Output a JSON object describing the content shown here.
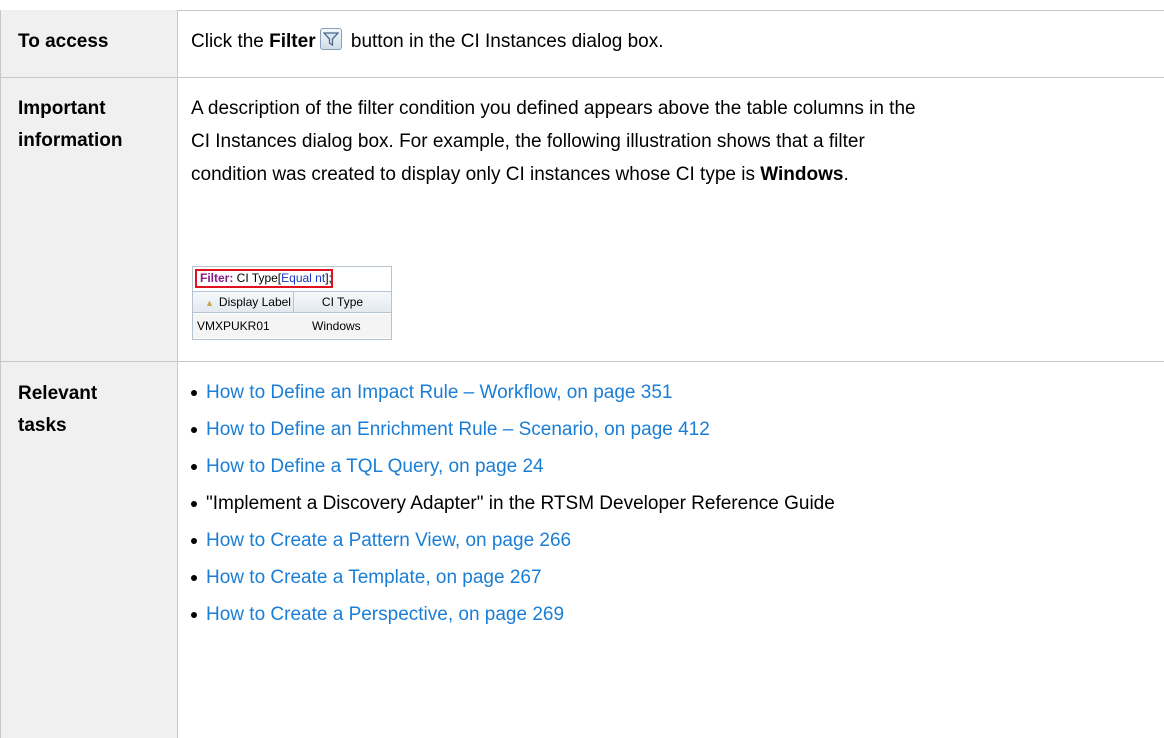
{
  "rows": {
    "access": {
      "label": "To access",
      "pre": "Click the ",
      "bold": "Filter",
      "post": " button in the CI Instances dialog box.",
      "icon": "filter-icon"
    },
    "important": {
      "label_line1": "Important",
      "label_line2": "information",
      "line1": "A description of the filter condition you defined appears above the table columns in the",
      "line2": "CI Instances dialog box. For example, the following illustration shows that a filter",
      "line3_pre": "condition was created to display only CI instances whose CI type is ",
      "line3_bold": "Windows",
      "line3_post": ".",
      "illustration": {
        "filter_keyword": "Filter:",
        "filter_middle": " CI Type[",
        "filter_value": "Equal nt",
        "filter_end": "];",
        "col1": "Display Label",
        "col2": "CI Type",
        "row_label": "VMXPUKR01",
        "row_type": "Windows"
      }
    },
    "tasks": {
      "label_line1": "Relevant",
      "label_line2": "tasks",
      "items": [
        {
          "text": "How to Define an Impact Rule – Workflow, on page 351",
          "link": true
        },
        {
          "text": "How to Define an Enrichment Rule – Scenario, on page 412",
          "link": true
        },
        {
          "text": "How to Define a TQL Query, on page 24",
          "link": true
        },
        {
          "text": "\"Implement a Discovery Adapter\" in the RTSM Developer Reference Guide",
          "link": false
        },
        {
          "text": "How to Create a Pattern View, on page 266",
          "link": true
        },
        {
          "text": "How to Create a Template, on page 267",
          "link": true
        },
        {
          "text": "How to Create a Perspective, on page 269",
          "link": true
        }
      ]
    }
  },
  "colors": {
    "link": "#1a7ed6",
    "label_bg": "#f0f0f0",
    "border": "#c8c8c8",
    "highlight_box": "#e0121f"
  }
}
